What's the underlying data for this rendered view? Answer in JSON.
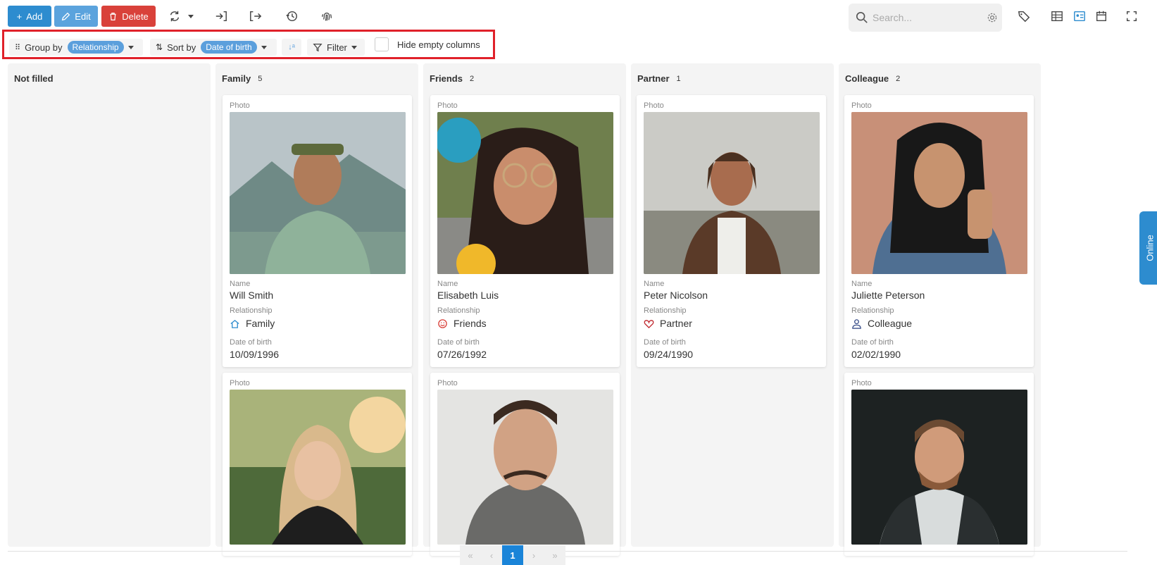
{
  "toolbar": {
    "add_label": "Add",
    "edit_label": "Edit",
    "delete_label": "Delete",
    "search_placeholder": "Search..."
  },
  "groupbar": {
    "group_by_label": "Group by",
    "group_by_value": "Relationship",
    "sort_by_label": "Sort by",
    "sort_by_value": "Date of birth",
    "filter_label": "Filter",
    "hide_empty_label": "Hide empty columns"
  },
  "columns": [
    {
      "title": "Not filled",
      "count": ""
    },
    {
      "title": "Family",
      "count": "5"
    },
    {
      "title": "Friends",
      "count": "2"
    },
    {
      "title": "Partner",
      "count": "1"
    },
    {
      "title": "Colleague",
      "count": "2"
    }
  ],
  "field_labels": {
    "photo": "Photo",
    "name": "Name",
    "relationship": "Relationship",
    "dob": "Date of birth"
  },
  "cards": [
    {
      "name": "Will Smith",
      "relationship": "Family",
      "dob": "10/09/1996",
      "icon": "home-icon"
    },
    {
      "name": "Elisabeth Luis",
      "relationship": "Friends",
      "dob": "07/26/1992",
      "icon": "smile-icon"
    },
    {
      "name": "Peter Nicolson",
      "relationship": "Partner",
      "dob": "09/24/1990",
      "icon": "heart-icon"
    },
    {
      "name": "Juliette Peterson",
      "relationship": "Colleague",
      "dob": "02/02/1990",
      "icon": "user-icon"
    }
  ],
  "side_tab": "Online",
  "pager": {
    "first": "«",
    "prev": "‹",
    "page": "1",
    "next": "›",
    "last": "»"
  },
  "colors": {
    "add": "#2d8ccf",
    "edit": "#5ba3dd",
    "delete": "#d9413a",
    "highlight": "#e0212a",
    "chip": "#5b9fdc"
  }
}
